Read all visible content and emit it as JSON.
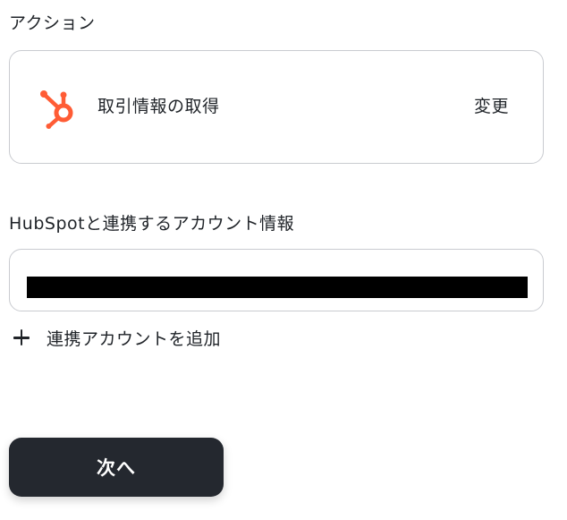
{
  "action_section": {
    "title": "アクション",
    "card": {
      "icon": "hubspot-logo-icon",
      "label": "取引情報の取得",
      "change_label": "変更"
    }
  },
  "account_section": {
    "title": "HubSpotと連携するアカウント情報",
    "selected_account": "[redacted]",
    "add_account_label": "連携アカウントを追加",
    "add_icon": "plus-icon"
  },
  "footer": {
    "next_label": "次へ"
  },
  "colors": {
    "hubspot_orange": "#ff5c35",
    "button_dark": "#24282f",
    "border": "#c9cbd0"
  }
}
